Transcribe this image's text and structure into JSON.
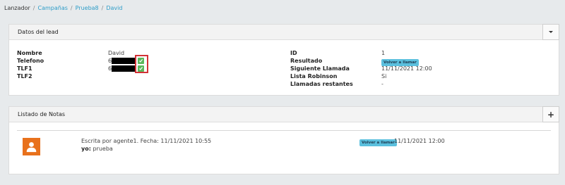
{
  "breadcrumb": {
    "items": [
      "Lanzador",
      "Campañas",
      "Prueba8",
      "David"
    ],
    "link_color": "#2e9dc8"
  },
  "lead_panel": {
    "title": "Datos del lead",
    "left": [
      {
        "label": "Nombre",
        "value": "David"
      },
      {
        "label": "Telefono",
        "value": "6"
      },
      {
        "label": "TLF1",
        "value": "6"
      },
      {
        "label": "TLF2",
        "value": ""
      }
    ],
    "right": [
      {
        "label": "ID",
        "value": "1"
      },
      {
        "label": "Resultado",
        "badge": "Volver a llamar"
      },
      {
        "label": "Siguiente Llamada",
        "value": "11/11/2021 12:00"
      },
      {
        "label": "Lista Robinson",
        "value": "Si"
      },
      {
        "label": "Llamadas restantes",
        "value": "-"
      }
    ]
  },
  "notes_panel": {
    "title": "Listado de Notas",
    "note": {
      "meta": "Escrita por agente1. Fecha: 11/11/2021 10:55",
      "author": "yo:",
      "text": "prueba",
      "badge": "Volver a llamar",
      "scheduled": "11/11/2021 12:00"
    }
  },
  "colors": {
    "badge": "#5bc0de",
    "call_icon": "#5cb85c",
    "highlight": "#d23236",
    "avatar": "#e8711c"
  },
  "icons": [
    "chevron-down-icon",
    "plus-icon",
    "phone-call-icon",
    "user-avatar-icon"
  ]
}
